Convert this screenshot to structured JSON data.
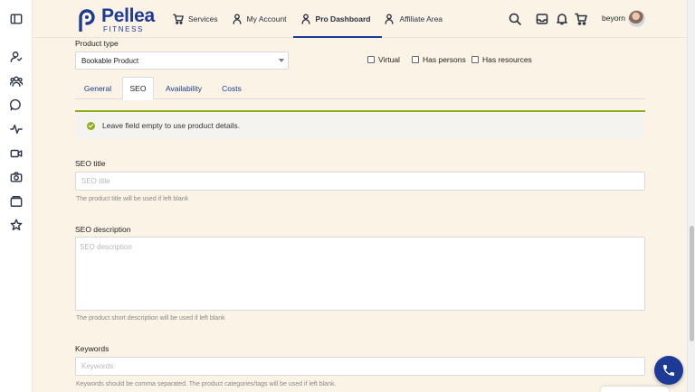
{
  "brand": {
    "name": "Pellea",
    "subtitle": "FITNESS",
    "color": "#1d3a96"
  },
  "sidebar": {
    "icons": [
      "sidebar-toggle-icon",
      "user-profile-icon",
      "users-group-icon",
      "chat-icon",
      "activity-icon",
      "video-icon",
      "camera-icon",
      "wallet-icon",
      "star-icon"
    ]
  },
  "nav": {
    "items": [
      {
        "label": "Services",
        "icon": "cart-icon"
      },
      {
        "label": "My Account",
        "icon": "user-icon"
      },
      {
        "label": "Pro Dashboard",
        "icon": "user-icon",
        "active": true
      },
      {
        "label": "Affiliate Area",
        "icon": "user-icon"
      }
    ]
  },
  "header": {
    "icons": [
      "search-icon",
      "inbox-icon",
      "bell-icon",
      "cart-icon"
    ],
    "username": "beyorn"
  },
  "form": {
    "product_type_label": "Product type",
    "product_type_value": "Bookable Product",
    "checkboxes": [
      {
        "label": "Virtual",
        "checked": false
      },
      {
        "label": "Has persons",
        "checked": false
      },
      {
        "label": "Has resources",
        "checked": false
      }
    ],
    "tabs": [
      "General",
      "SEO",
      "Availability",
      "Costs"
    ],
    "active_tab": "SEO",
    "notice": "Leave field empty to use product details.",
    "seo_title": {
      "label": "SEO title",
      "placeholder": "SEO title",
      "value": "",
      "hint": "The product title will be used if left blank"
    },
    "seo_description": {
      "label": "SEO description",
      "placeholder": "SEO description",
      "value": "",
      "hint": "The product short description will be used if left blank"
    },
    "keywords": {
      "label": "Keywords",
      "placeholder": "Keywords",
      "value": "",
      "hint": "Keywords should be comma separated. The product categories/tags will be used if left blank."
    }
  },
  "colors": {
    "accent": "#1d3a96",
    "notice_border": "#8fae1b",
    "background": "#fbf3e6"
  }
}
